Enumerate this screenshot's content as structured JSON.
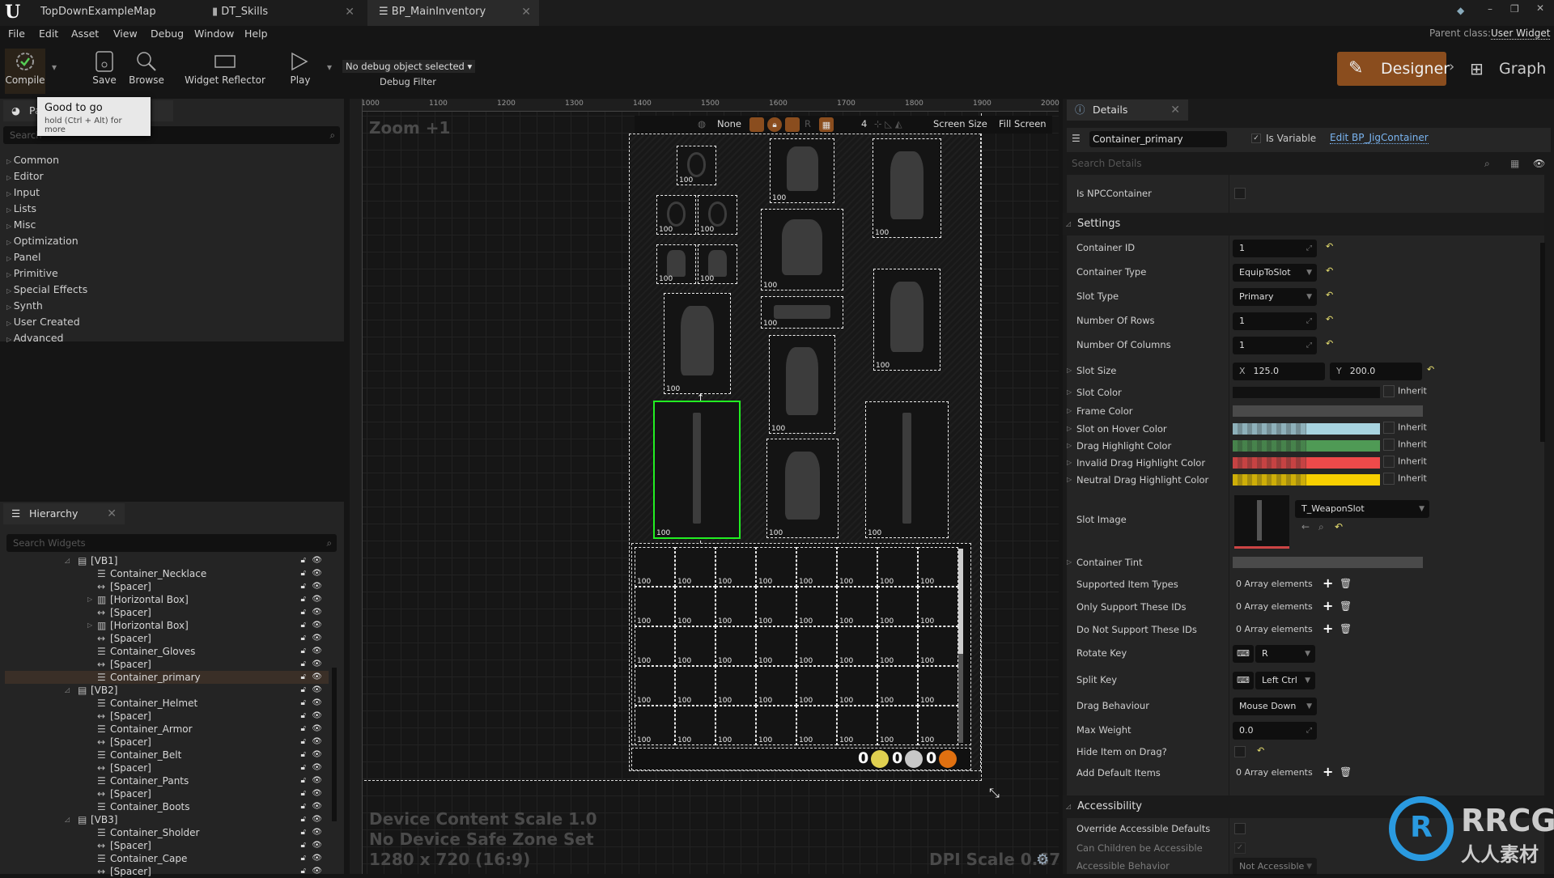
{
  "tabs": [
    {
      "label": "TopDownExampleMap"
    },
    {
      "label": "DT_Skills"
    },
    {
      "label": "BP_MainInventory"
    }
  ],
  "menu": [
    "File",
    "Edit",
    "Asset",
    "View",
    "Debug",
    "Window",
    "Help"
  ],
  "parent_class": {
    "label": "Parent class:",
    "value": "User Widget"
  },
  "toolbar": {
    "compile": "Compile",
    "save": "Save",
    "browse": "Browse",
    "reflector": "Widget Reflector",
    "play": "Play",
    "debug_select": "No debug object selected",
    "debug_filter": "Debug Filter"
  },
  "modes": {
    "designer": "Designer",
    "graph": "Graph",
    "accent": "#8a4d1e"
  },
  "tooltip": {
    "title": "Good to go",
    "hint": "hold (Ctrl + Alt) for more"
  },
  "palette": {
    "tab": "Pa",
    "search_placeholder": "Search",
    "categories": [
      "Common",
      "Editor",
      "Input",
      "Lists",
      "Misc",
      "Optimization",
      "Panel",
      "Primitive",
      "Special Effects",
      "Synth",
      "User Created",
      "Advanced"
    ]
  },
  "hierarchy": {
    "tab": "Hierarchy",
    "search_placeholder": "Search Widgets",
    "rows": [
      {
        "label": "[VB1]",
        "kind": "vbox"
      },
      {
        "label": "Container_Necklace",
        "kind": "widget"
      },
      {
        "label": "[Spacer]",
        "kind": "spacer"
      },
      {
        "label": "[Horizontal Box]",
        "kind": "hbox"
      },
      {
        "label": "[Spacer]",
        "kind": "spacer"
      },
      {
        "label": "[Horizontal Box]",
        "kind": "hbox"
      },
      {
        "label": "[Spacer]",
        "kind": "spacer"
      },
      {
        "label": "Container_Gloves",
        "kind": "widget"
      },
      {
        "label": "[Spacer]",
        "kind": "spacer"
      },
      {
        "label": "Container_primary",
        "kind": "widget",
        "selected": true
      },
      {
        "label": "[VB2]",
        "kind": "vbox"
      },
      {
        "label": "Container_Helmet",
        "kind": "widget"
      },
      {
        "label": "[Spacer]",
        "kind": "spacer"
      },
      {
        "label": "Container_Armor",
        "kind": "widget"
      },
      {
        "label": "[Spacer]",
        "kind": "spacer"
      },
      {
        "label": "Container_Belt",
        "kind": "widget"
      },
      {
        "label": "[Spacer]",
        "kind": "spacer"
      },
      {
        "label": "Container_Pants",
        "kind": "widget"
      },
      {
        "label": "[Spacer]",
        "kind": "spacer"
      },
      {
        "label": "Container_Boots",
        "kind": "widget"
      },
      {
        "label": "[VB3]",
        "kind": "vbox"
      },
      {
        "label": "Container_Sholder",
        "kind": "widget"
      },
      {
        "label": "[Spacer]",
        "kind": "spacer"
      },
      {
        "label": "Container_Cape",
        "kind": "widget"
      },
      {
        "label": "[Spacer]",
        "kind": "spacer"
      }
    ]
  },
  "canvas": {
    "zoom": "Zoom +1",
    "ruler": [
      "1000",
      "1100",
      "1200",
      "1300",
      "1400",
      "1500",
      "1600",
      "1700",
      "1800",
      "1900",
      "2000"
    ],
    "toolbar": {
      "none": "None",
      "grid_count": "4",
      "r": "R",
      "screen_size": "Screen Size",
      "fill_screen": "Fill Screen"
    },
    "slot_count_label": "100",
    "currency": [
      {
        "value": "0",
        "color": "#e0d050"
      },
      {
        "value": "0",
        "color": "#c8c8c8"
      },
      {
        "value": "0",
        "color": "#e07010"
      }
    ],
    "device_scale": "Device Content Scale 1.0",
    "safe_zone": "No Device Safe Zone Set",
    "resolution": "1280 x 720 (16:9)",
    "dpi": "DPI Scale 0.67"
  },
  "details": {
    "tab": "Details",
    "widget_name": "Container_primary",
    "is_variable": "Is Variable",
    "edit_link": "Edit BP_JigContainer",
    "search_placeholder": "Search Details",
    "is_npc": "Is NPCContainer",
    "settings": "Settings",
    "container_id": {
      "label": "Container ID",
      "value": "1"
    },
    "container_type": {
      "label": "Container Type",
      "value": "EquipToSlot"
    },
    "slot_type": {
      "label": "Slot Type",
      "value": "Primary"
    },
    "rows": {
      "label": "Number Of Rows",
      "value": "1"
    },
    "cols": {
      "label": "Number Of Columns",
      "value": "1"
    },
    "slot_size": {
      "label": "Slot Size",
      "x_label": "X",
      "x": "125.0",
      "y_label": "Y",
      "y": "200.0"
    },
    "inherit": "Inherit",
    "colors": [
      {
        "label": "Slot Color",
        "color": "#111111",
        "inherit": true
      },
      {
        "label": "Frame Color",
        "color": "#4a4a4a",
        "inherit": false
      },
      {
        "label": "Slot on Hover Color",
        "color": "#a8d4e0",
        "inherit": true
      },
      {
        "label": "Drag Highlight Color",
        "color": "#4f9a55",
        "inherit": true
      },
      {
        "label": "Invalid Drag Highlight Color",
        "color": "#ee4a4a",
        "inherit": true
      },
      {
        "label": "Neutral Drag Highlight Color",
        "color": "#f8d000",
        "inherit": true
      }
    ],
    "slot_image": {
      "label": "Slot Image",
      "value": "T_WeaponSlot"
    },
    "container_tint": "Container Tint",
    "arrays": [
      {
        "label": "Supported Item Types",
        "value": "0 Array elements"
      },
      {
        "label": "Only Support These IDs",
        "value": "0 Array elements"
      },
      {
        "label": "Do Not Support These IDs",
        "value": "0 Array elements"
      }
    ],
    "rotate_key": {
      "label": "Rotate Key",
      "value": "R"
    },
    "split_key": {
      "label": "Split Key",
      "value": "Left Ctrl"
    },
    "drag_behaviour": {
      "label": "Drag Behaviour",
      "value": "Mouse Down"
    },
    "max_weight": {
      "label": "Max Weight",
      "value": "0.0"
    },
    "hide_on_drag": {
      "label": "Hide Item on Drag?"
    },
    "default_items": {
      "label": "Add Default Items",
      "value": "0 Array elements"
    },
    "accessibility": "Accessibility",
    "override_acc": "Override Accessible Defaults",
    "children_acc": "Can Children be Accessible",
    "acc_behavior": {
      "label": "Accessible Behavior",
      "value": "Not Accessible"
    }
  },
  "watermark": {
    "text": "RRCG",
    "sub": "人人素材"
  }
}
